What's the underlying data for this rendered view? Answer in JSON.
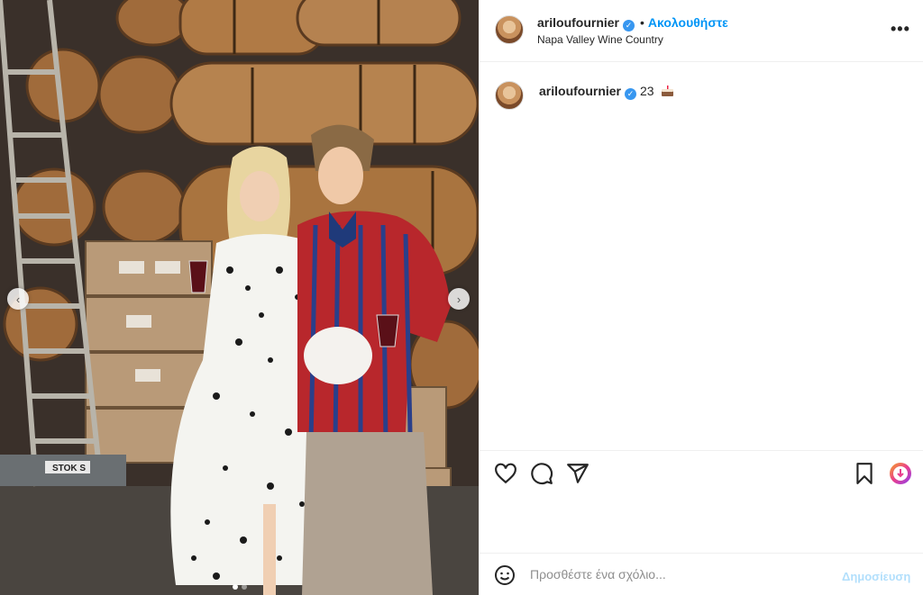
{
  "post": {
    "username": "ariloufournier",
    "follow_label": "Ακολουθήστε",
    "location": "Napa Valley Wine Country",
    "more_label": "•••",
    "caption_count": "23",
    "verified_glyph": "✓"
  },
  "photo": {
    "prev_glyph": "‹",
    "next_glyph": "›",
    "slide_count": 2,
    "active_slide": 1,
    "crate_label": "STOK S"
  },
  "comment": {
    "placeholder": "Προσθέστε ένα σχόλιο...",
    "post_label": "Δημοσίευση"
  },
  "icons": [
    "heart-icon",
    "comment-icon",
    "share-icon",
    "bookmark-icon",
    "download-badge-icon",
    "emoji-icon",
    "cake-emoji-icon"
  ],
  "colors": {
    "accent": "#0095f6",
    "verified": "#3897f0",
    "border": "#efefef",
    "post_disabled": "#b2dffc"
  }
}
